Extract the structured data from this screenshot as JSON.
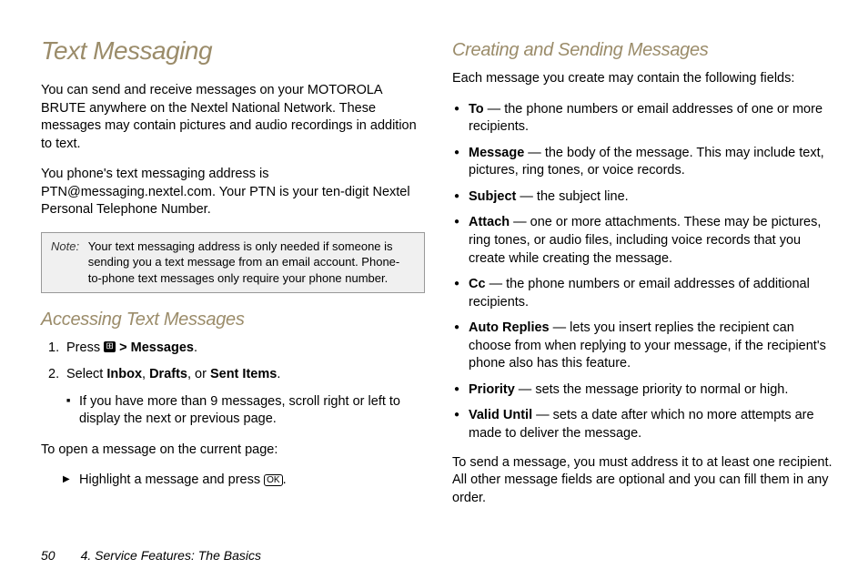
{
  "left": {
    "title": "Text Messaging",
    "intro1": "You can send and receive messages on your MOTOROLA BRUTE anywhere on the Nextel National Network. These messages may contain pictures and audio recordings in addition to text.",
    "intro2": "You phone's text messaging address is PTN@messaging.nextel.com. Your PTN is your ten-digit Nextel Personal Telephone Number.",
    "note_label": "Note:",
    "note_body": "Your text messaging address is only needed if someone is sending you a text message from an email account. Phone-to-phone text messages only require your phone number.",
    "section2_title": "Accessing Text Messages",
    "step1_a": "Press ",
    "step1_b": " > ",
    "step1_c": "Messages",
    "step1_d": ".",
    "step2_a": "Select ",
    "step2_b": "Inbox",
    "step2_c": ", ",
    "step2_d": "Drafts",
    "step2_e": ", or ",
    "step2_f": "Sent Items",
    "step2_g": ".",
    "step2_sub": "If you have more than 9 messages, scroll right or left to display the next or previous page.",
    "open_intro": "To open a message on the current page:",
    "open_action_a": "Highlight a message and press ",
    "open_action_b": ".",
    "ok_label": "OK"
  },
  "right": {
    "title": "Creating and Sending Messages",
    "intro": "Each message you create may contain the following fields:",
    "fields": [
      {
        "name": "To",
        "desc": " — the phone numbers or email addresses of one or more recipients."
      },
      {
        "name": "Message",
        "desc": " — the body of the message. This may include text, pictures, ring tones, or voice records."
      },
      {
        "name": "Subject",
        "desc": " — the subject line."
      },
      {
        "name": "Attach",
        "desc": " — one or more attachments. These may be pictures, ring tones, or audio files, including voice records that you create while creating the message."
      },
      {
        "name": "Cc",
        "desc": " — the phone numbers or email addresses of additional recipients."
      },
      {
        "name": "Auto Replies",
        "desc": " — lets you insert replies the recipient can choose from when replying to your message, if the recipient's phone also has this feature."
      },
      {
        "name": "Priority",
        "desc": " — sets the message priority to normal or high."
      },
      {
        "name": "Valid Until",
        "desc": " — sets a date after which no more attempts are made to deliver the message."
      }
    ],
    "closing": "To send a message, you must address it to at least one recipient. All other message fields are optional and you can fill them in any order."
  },
  "footer": {
    "page": "50",
    "chapter": "4. Service Features: The Basics"
  }
}
